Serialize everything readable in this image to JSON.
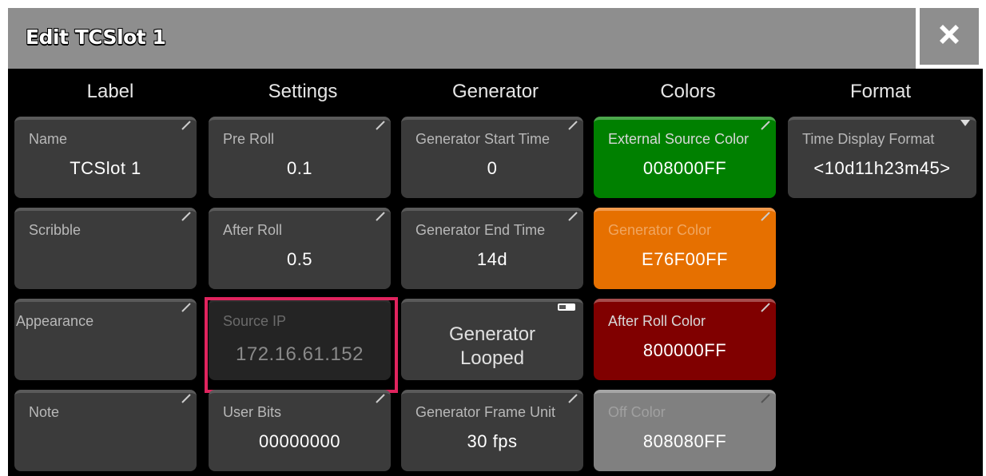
{
  "window": {
    "title": "Edit TCSlot 1"
  },
  "columns": [
    "Label",
    "Settings",
    "Generator",
    "Colors",
    "Format"
  ],
  "tiles": {
    "name": {
      "label": "Name",
      "value": "TCSlot 1"
    },
    "scribble": {
      "label": "Scribble",
      "value": ""
    },
    "appearance": {
      "label": "Appearance",
      "value": ""
    },
    "note": {
      "label": "Note",
      "value": ""
    },
    "pre_roll": {
      "label": "Pre Roll",
      "value": "0.1"
    },
    "after_roll": {
      "label": "After Roll",
      "value": "0.5"
    },
    "source_ip": {
      "label": "Source IP",
      "value": "172.16.61.152"
    },
    "user_bits": {
      "label": "User Bits",
      "value": "00000000"
    },
    "gen_start": {
      "label": "Generator Start Time",
      "value": "0"
    },
    "gen_end": {
      "label": "Generator End Time",
      "value": "14d"
    },
    "gen_looped": {
      "line1": "Generator",
      "line2": "Looped"
    },
    "gen_frame_unit": {
      "label": "Generator Frame Unit",
      "value": "30 fps"
    },
    "ext_src_color": {
      "label": "External Source Color",
      "value": "008000FF",
      "color": "#008000"
    },
    "gen_color": {
      "label": "Generator Color",
      "value": "E76F00FF",
      "color": "#E76F00"
    },
    "after_roll_color": {
      "label": "After Roll Color",
      "value": "800000FF",
      "color": "#800000"
    },
    "off_color": {
      "label": "Off Color",
      "value": "808080FF",
      "color": "#808080"
    },
    "time_display_format": {
      "label": "Time Display Format",
      "value": "<10d11h23m45>"
    }
  },
  "icons": {
    "close": "close-x-icon",
    "edit_corner": "pencil-corner-icon",
    "toggle": "toggle-icon",
    "dropdown": "dropdown-triangle-icon"
  }
}
